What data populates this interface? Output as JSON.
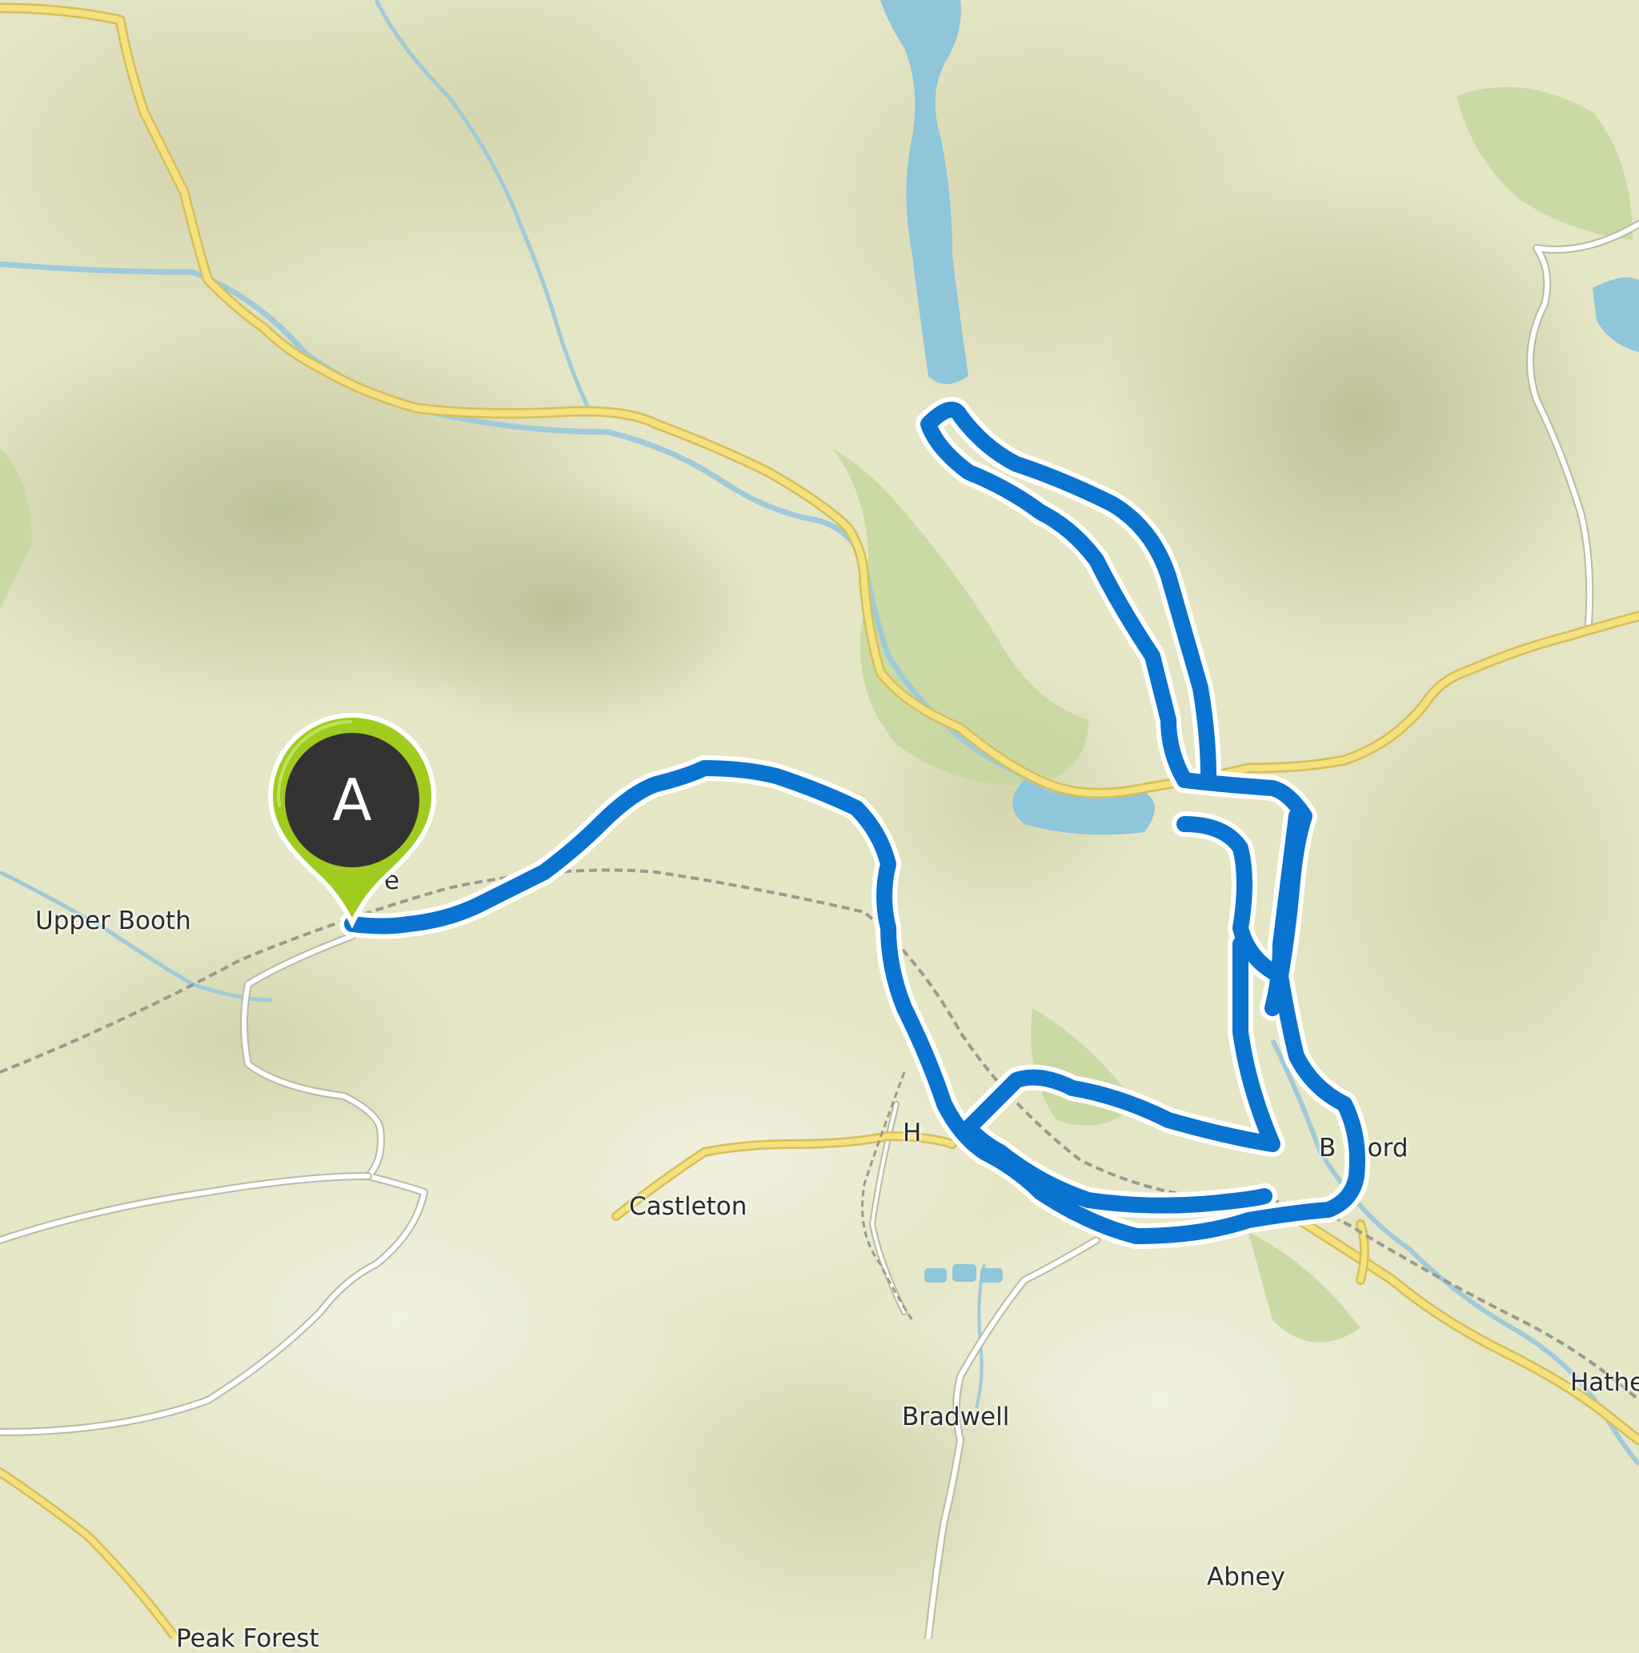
{
  "map": {
    "places": [
      {
        "id": "upper-booth",
        "label": "Upper Booth"
      },
      {
        "id": "castleton",
        "label": "Castleton"
      },
      {
        "id": "h-fragment",
        "label": "H"
      },
      {
        "id": "bamford",
        "label": "B    ord"
      },
      {
        "id": "hathersage",
        "label": "Hathe"
      },
      {
        "id": "bradwell",
        "label": "Bradwell"
      },
      {
        "id": "abney",
        "label": "Abney"
      },
      {
        "id": "peak-forest",
        "label": "Peak Forest"
      },
      {
        "id": "edale-fragment",
        "label": "e"
      }
    ],
    "start_marker": {
      "label": "A"
    },
    "colors": {
      "route": "#0a73cf",
      "route_outline": "#ffffff",
      "major_road": "#f0dd78",
      "minor_road": "#ffffff",
      "water": "#8fc6d9",
      "woodland": "#c8d9a0",
      "marker_pin": "#9fcc1e",
      "marker_disc": "#333333"
    }
  }
}
